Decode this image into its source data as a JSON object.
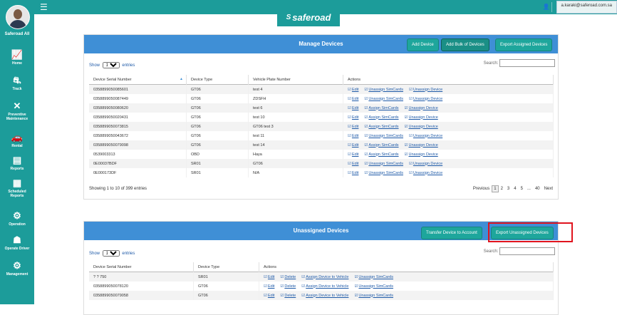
{
  "sidebar": {
    "user_name": "Saferoad All",
    "items": [
      {
        "label": "Home",
        "icon": "chart-icon",
        "glyph": "📈"
      },
      {
        "label": "Track",
        "icon": "route-icon",
        "glyph": "⛐"
      },
      {
        "label": "Preventive\nMaintenance",
        "icon": "wrench-icon",
        "glyph": "✕"
      },
      {
        "label": "Rental",
        "icon": "car-icon",
        "glyph": "🚗"
      },
      {
        "label": "Reports",
        "icon": "board-icon",
        "glyph": "▤"
      },
      {
        "label": "Scheduled\nReports",
        "icon": "clipboard-icon",
        "glyph": "▦"
      },
      {
        "label": "Operation",
        "icon": "gears-icon",
        "glyph": "⚙"
      },
      {
        "label": "Operate Driver",
        "icon": "driver-icon",
        "glyph": "☗"
      },
      {
        "label": "Management",
        "icon": "cog-icon",
        "glyph": "⚙"
      }
    ]
  },
  "header": {
    "logo_text": "saferoad",
    "email": "a.karaki@saferoad.com.sa"
  },
  "manage": {
    "title": "Manage Devices",
    "buttons": {
      "add": "Add Device",
      "bulk": "Add Bulk of Devices",
      "export": "Export Assigned Devices"
    },
    "show": "Show",
    "show_value": "10",
    "entries": "entries",
    "search": "Search:",
    "columns": [
      "Device Serial Number",
      "Device Type",
      "Vehicle Plate Number",
      "Actions"
    ],
    "rows": [
      {
        "serial": "0358899050085601",
        "type": "GT06",
        "plate": "test 4",
        "actions": [
          "Edit",
          "Unassign SimCards",
          "Unassign Device"
        ]
      },
      {
        "serial": "0358899050087449",
        "type": "GT06",
        "plate": "ZDSFH",
        "actions": [
          "Edit",
          "Unassign SimCards",
          "Unassign Device"
        ]
      },
      {
        "serial": "0358899050080620",
        "type": "GT06",
        "plate": "test 6",
        "actions": [
          "Edit",
          "Assign SimCards",
          "Unassign Device"
        ]
      },
      {
        "serial": "0358899050020431",
        "type": "GT06",
        "plate": "test 10",
        "actions": [
          "Edit",
          "Assign SimCards",
          "Unassign Device"
        ]
      },
      {
        "serial": "0358899050073815",
        "type": "GT06",
        "plate": "GT06 test 3",
        "actions": [
          "Edit",
          "Assign SimCards",
          "Unassign Device"
        ]
      },
      {
        "serial": "0358899050043672",
        "type": "GT06",
        "plate": "test 11",
        "actions": [
          "Edit",
          "Unassign SimCards",
          "Unassign Device"
        ]
      },
      {
        "serial": "0358899050079098",
        "type": "GT06",
        "plate": "test 14",
        "actions": [
          "Edit",
          "Assign SimCards",
          "Unassign Device"
        ]
      },
      {
        "serial": "0539003313",
        "type": "OBD",
        "plate": "Haya",
        "actions": [
          "Edit",
          "Assign SimCards",
          "Unassign Device"
        ]
      },
      {
        "serial": "0E00037BDF",
        "type": "SR01",
        "plate": "GT06",
        "actions": [
          "Edit",
          "Unassign SimCards",
          "Unassign Device"
        ]
      },
      {
        "serial": "0E000173DF",
        "type": "SR01",
        "plate": "N/A",
        "actions": [
          "Edit",
          "Unassign SimCards",
          "Unassign Device"
        ]
      }
    ],
    "info": "Showing 1 to 10 of 399 entries",
    "pager": {
      "previous": "Previous",
      "pages": [
        "1",
        "2",
        "3",
        "4",
        "5",
        "...",
        "40"
      ],
      "next": "Next"
    }
  },
  "unassigned": {
    "title": "Unassigned Devices",
    "buttons": {
      "transfer": "Transfer Device to Account",
      "export": "Export Unassigned Devices"
    },
    "show": "Show",
    "show_value": "10",
    "entries": "entries",
    "search": "Search:",
    "columns": [
      "Device Serial Number",
      "Device Type",
      "Actions"
    ],
    "rows": [
      {
        "serial": "? ? 750",
        "type": "SR01",
        "actions": [
          "Edit",
          "Delete",
          "Assign Device to Vehicle",
          "Unassign SimCards"
        ]
      },
      {
        "serial": "0358899050078120",
        "type": "GT06",
        "actions": [
          "Edit",
          "Delete",
          "Assign Device to Vehicle",
          "Unassign SimCards"
        ]
      },
      {
        "serial": "0358899050079058",
        "type": "GT06",
        "actions": [
          "Edit",
          "Delete",
          "Assign Device to Vehicle",
          "Unassign SimCards"
        ]
      }
    ]
  },
  "colors": {
    "teal": "#1c9c9a",
    "header_blue": "#3f8fd6",
    "btn_teal": "#1ea69c",
    "highlight": "#e0141e"
  }
}
